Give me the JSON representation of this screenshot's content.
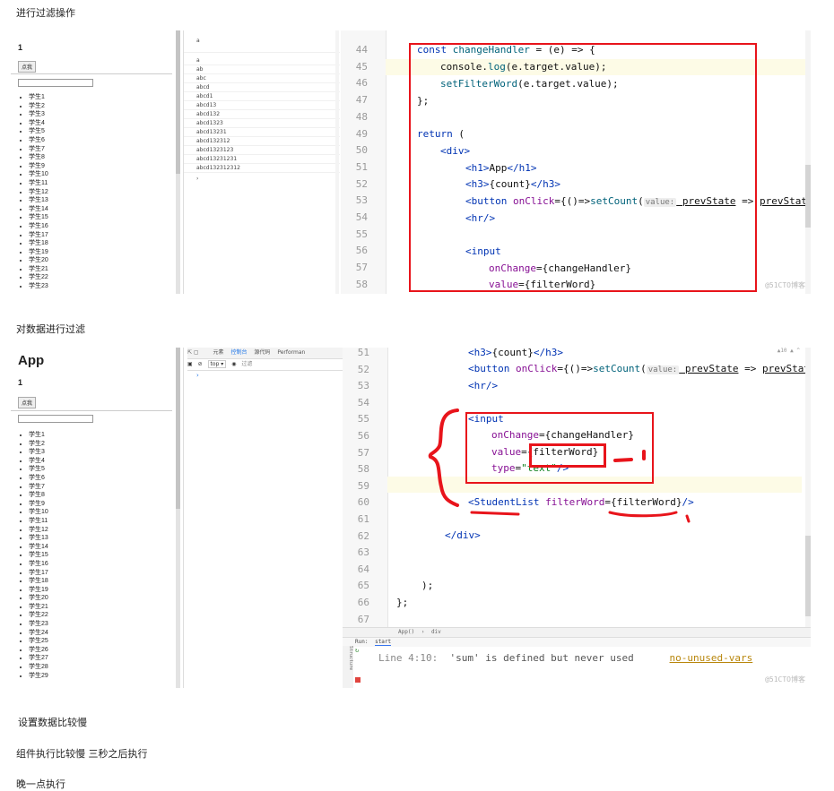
{
  "captions": [
    "进行过滤操作",
    "对数据进行过滤",
    "设置数据比较慢",
    "组件执行比较慢 三秒之后执行",
    "晚一点执行"
  ],
  "shot1": {
    "app_title": "",
    "count": "1",
    "button_label": "点我",
    "students": [
      "学生1",
      "学生2",
      "学生3",
      "学生4",
      "学生5",
      "学生6",
      "学生7",
      "学生8",
      "学生9",
      "学生10",
      "学生11",
      "学生12",
      "学生13",
      "学生14",
      "学生15",
      "学生16",
      "学生17",
      "学生18",
      "学生19",
      "学生20",
      "学生21",
      "学生22",
      "学生23"
    ],
    "console_top": "a",
    "console_logs": [
      "a",
      "ab",
      "abc",
      "abcd",
      "abcd1",
      "abcd13",
      "abcd132",
      "abcd1323",
      "abcd13231",
      "abcd132312",
      "abcd1323123",
      "abcd13231231",
      "abcd132312312"
    ],
    "console_prompt": "›",
    "line_numbers": [
      "44",
      "45",
      "46",
      "47",
      "48",
      "49",
      "50",
      "51",
      "52",
      "53",
      "54",
      "55",
      "56",
      "57",
      "58"
    ],
    "code": {
      "l44": [
        "const ",
        "changeHandler",
        " = (e) => {"
      ],
      "l45": [
        "console.",
        "log",
        "(e.target.value);"
      ],
      "l46": [
        "setFilterWord",
        "(e.target.value);"
      ],
      "l47": "};",
      "l49": [
        "return",
        " ("
      ],
      "l50": "<div>",
      "l51": [
        "<h1>",
        "App",
        "</h1>"
      ],
      "l52": [
        "<h3>",
        "{count}",
        "</h3>"
      ],
      "l53": [
        "<button ",
        "onClick",
        "={()=>",
        "setCount",
        "(",
        "value:",
        " prevState",
        " => ",
        "prevState"
      ],
      "l54": "<hr/>",
      "l56": "<input",
      "l57": [
        "onChange",
        "={changeHandler}"
      ],
      "l58": [
        "value",
        "={filterWord}"
      ]
    },
    "watermark": "@51CTO博客"
  },
  "shot2": {
    "app_title": "App",
    "count": "1",
    "button_label": "点我",
    "students": [
      "学生1",
      "学生2",
      "学生3",
      "学生4",
      "学生5",
      "学生6",
      "学生7",
      "学生8",
      "学生9",
      "学生10",
      "学生11",
      "学生12",
      "学生13",
      "学生14",
      "学生15",
      "学生16",
      "学生17",
      "学生18",
      "学生19",
      "学生20",
      "学生21",
      "学生22",
      "学生23",
      "学生24",
      "学生25",
      "学生26",
      "学生27",
      "学生28",
      "学生29"
    ],
    "devtools_tabs": [
      "元素",
      "控制台",
      "源代码",
      "Performan"
    ],
    "devtools_filter": "top ▾",
    "devtools_filter_placeholder": "过滤",
    "console_prompt": "›",
    "line_numbers": [
      "51",
      "52",
      "53",
      "54",
      "55",
      "56",
      "57",
      "58",
      "59",
      "60",
      "61",
      "62",
      "63",
      "64",
      "65",
      "66",
      "67"
    ],
    "code": {
      "l51": [
        "<h3>",
        "{count}",
        "</h3>"
      ],
      "l52": [
        "<button ",
        "onClick",
        "={()=>",
        "setCount",
        "(",
        "value:",
        " prevState",
        " => ",
        "prevState"
      ],
      "l53": "<hr/>",
      "l55": "<input",
      "l56": [
        "onChange",
        "={changeHandler}"
      ],
      "l57": [
        "value",
        "=",
        "{filterWord}"
      ],
      "l58": [
        "type",
        "=",
        "\"text\"",
        "/>"
      ],
      "l60": [
        "<",
        "StudentList",
        " filterWord",
        "=",
        "{filterWord}",
        "/>"
      ],
      "l62": "</div>",
      "l65": ");",
      "l66": "};"
    },
    "breadcrumb": [
      "App()",
      "div"
    ],
    "run_tab": "Run:",
    "run_config": "start",
    "structure_label": "Structure",
    "lint_line": "Line 4:10:",
    "lint_msg": "'sum' is defined but never used",
    "lint_rule": "no-unused-vars",
    "warn_badge": "▲10 ▲ ^",
    "watermark": "@51CTO博客"
  }
}
